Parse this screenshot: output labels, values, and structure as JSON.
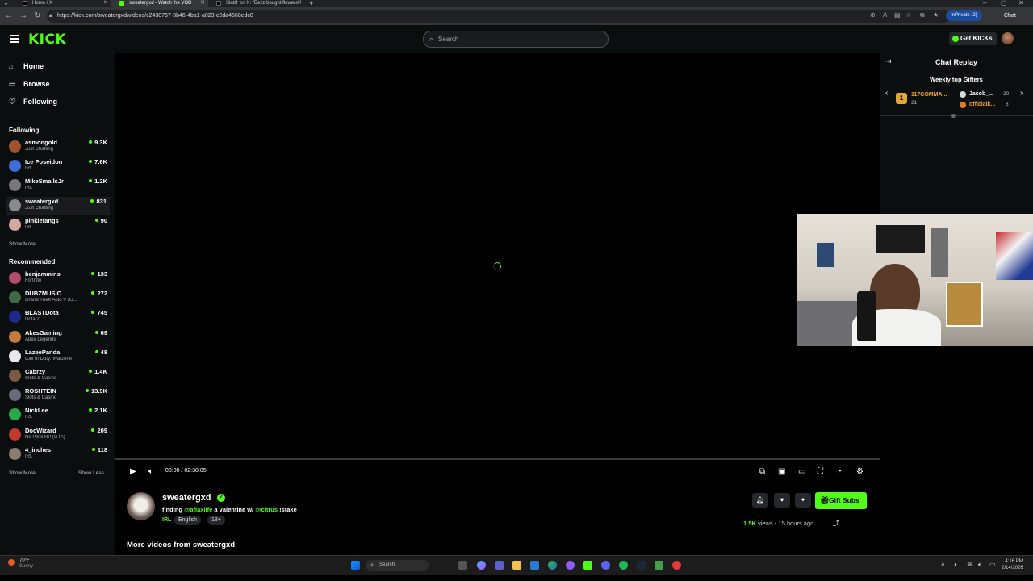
{
  "browser": {
    "tabs": [
      {
        "title": "Home / X",
        "color": "#000000"
      },
      {
        "title": "sweatergxd - Watch the VOD",
        "color": "#53fc18"
      },
      {
        "title": "Slatt† on X: \"Dezz bought flowers",
        "color": "#000000"
      }
    ],
    "url": "https://kick.com/sweatergxd/videos/c2430757-3b46-4ba1-a023-c2da4568edc0",
    "inprivate_label": "InPrivate (2)",
    "chat_label": "Chat"
  },
  "header": {
    "logo": "KICK",
    "search_placeholder": "Search",
    "get_kicks_label": "Get KICKs"
  },
  "sidebar": {
    "nav": [
      {
        "label": "Home",
        "icon": "home-icon"
      },
      {
        "label": "Browse",
        "icon": "browse-icon"
      },
      {
        "label": "Following",
        "icon": "heart-icon"
      }
    ],
    "following_title": "Following",
    "following": [
      {
        "name": "asmongold",
        "category": "Just Chatting",
        "viewers": "9.3K",
        "color": "#a0522d"
      },
      {
        "name": "Ice Poseidon",
        "category": "IRL",
        "viewers": "7.6K",
        "color": "#3a6fd8"
      },
      {
        "name": "MikeSmallsJr",
        "category": "IRL",
        "viewers": "1.2K",
        "color": "#777777"
      },
      {
        "name": "sweatergxd",
        "category": "Just Chatting",
        "viewers": "831",
        "color": "#8a8a8a"
      },
      {
        "name": "pinkiefangs",
        "category": "IRL",
        "viewers": "90",
        "color": "#d8a6a0"
      }
    ],
    "show_more": "Show More",
    "recommended_title": "Recommended",
    "recommended": [
      {
        "name": "benjammins",
        "category": "Fortnite",
        "viewers": "133",
        "color": "#b04c6c"
      },
      {
        "name": "DUBZMUSIC",
        "category": "Grand Theft Auto V (G...",
        "viewers": "272",
        "color": "#3d6b44"
      },
      {
        "name": "BLASTDota",
        "category": "Dota 2",
        "viewers": "745",
        "color": "#1d2a8c"
      },
      {
        "name": "AkesGaming",
        "category": "Apex Legends",
        "viewers": "69",
        "color": "#c27b3a"
      },
      {
        "name": "LazeePanda",
        "category": "Call of Duty: Warzone",
        "viewers": "48",
        "color": "#e8e8e8"
      },
      {
        "name": "Cabrzy",
        "category": "Slots & Casino",
        "viewers": "1.4K",
        "color": "#7a5a45"
      },
      {
        "name": "ROSHTEIN",
        "category": "Slots & Casino",
        "viewers": "13.9K",
        "color": "#6a6a7a"
      },
      {
        "name": "NickLee",
        "category": "IRL",
        "viewers": "2.1K",
        "color": "#2aa84a"
      },
      {
        "name": "DocWizard",
        "category": "No Pixel RP (GTA)",
        "viewers": "209",
        "color": "#c0392b"
      },
      {
        "name": "4_inches",
        "category": "IRL",
        "viewers": "118",
        "color": "#8c7b70"
      }
    ],
    "show_more_2": "Show More",
    "show_less": "Show Less"
  },
  "player": {
    "time": "00:00 / 02:38:05",
    "progress": 0
  },
  "chat": {
    "title": "Chat Replay",
    "gifters_title": "Weekly top Gifters",
    "gifters": [
      {
        "name": "117COMMA...",
        "count": "21",
        "rank": "1"
      },
      {
        "name": "Jacob_...",
        "count": "20"
      },
      {
        "name": "officialk...",
        "count": "8"
      }
    ]
  },
  "stream": {
    "streamer": "sweatergxd",
    "title_parts": [
      "finding ",
      "@aflaxlife",
      " a valentine w/ ",
      "@citrus",
      " !stake"
    ],
    "category": "IRL",
    "tags": [
      "English",
      "18+"
    ],
    "gift_subs_label": "Gift Subs",
    "views": "1.5K",
    "views_suffix": "views",
    "ago": "15 hours ago",
    "more_videos": "More videos from sweatergxd"
  },
  "taskbar": {
    "weather_temp": "70°F",
    "weather_desc": "Sunny",
    "search_label": "Search",
    "time": "4:16 PM",
    "date": "2/14/2026"
  }
}
